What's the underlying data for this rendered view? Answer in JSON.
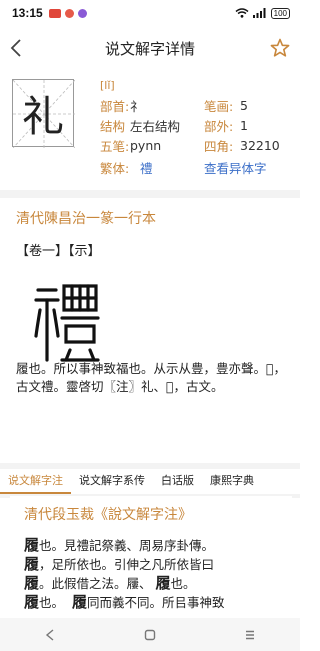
{
  "status_bar": {
    "time": "13:15",
    "battery": "100"
  },
  "header": {
    "title": "说文解字详情"
  },
  "char_info": {
    "character": "礼",
    "pinyin": "[lǐ]",
    "rows": [
      {
        "label": "部首:",
        "value": "礻",
        "label2": "笔画:",
        "value2": "5"
      },
      {
        "label": "结构",
        "value": "左右结构",
        "label2": "部外:",
        "value2": "1"
      },
      {
        "label": "五笔:",
        "value": "pynn",
        "label2": "四角:",
        "value2": "32210"
      }
    ],
    "traditional_label": "繁体:",
    "traditional_value": "禮",
    "variant_link": "查看异体字"
  },
  "shuowen": {
    "title": "清代陳昌治一篆一行本",
    "tags": "【卷一】【示】",
    "seal_char": "禮",
    "text": "履也。所以事神致福也。从示从豊，豊亦聲。𥛫，古文禮。靈啓切〖注〗礼、𥛫，古文。"
  },
  "tabs": [
    "说文解字注",
    "说文解字系传",
    "白话版",
    "康熙字典"
  ],
  "duan": {
    "title": "清代段玉裁《說文解字注》",
    "lines": [
      {
        "big": "履",
        "rest": "也。見禮記祭義、周易序卦傳。"
      },
      {
        "big": "履",
        "rest": "，足所依也。引伸之凡所依皆曰"
      },
      {
        "big": "履",
        "rest": "。此假借之法。屨、"
      },
      {
        "big": "履",
        "rest": "也。"
      }
    ],
    "line3_tail": {
      "big": "履",
      "rest": "也。"
    },
    "line4_tail": {
      "big": "履",
      "rest": "同而義不同。所㠯事神致"
    }
  },
  "colors": {
    "accent": "#c8873c",
    "link": "#3c6fc8"
  },
  "icons": [
    "back-arrow-icon",
    "star-icon",
    "wifi-icon",
    "signal-icon",
    "nav-back-icon",
    "nav-home-icon",
    "nav-recent-icon"
  ]
}
